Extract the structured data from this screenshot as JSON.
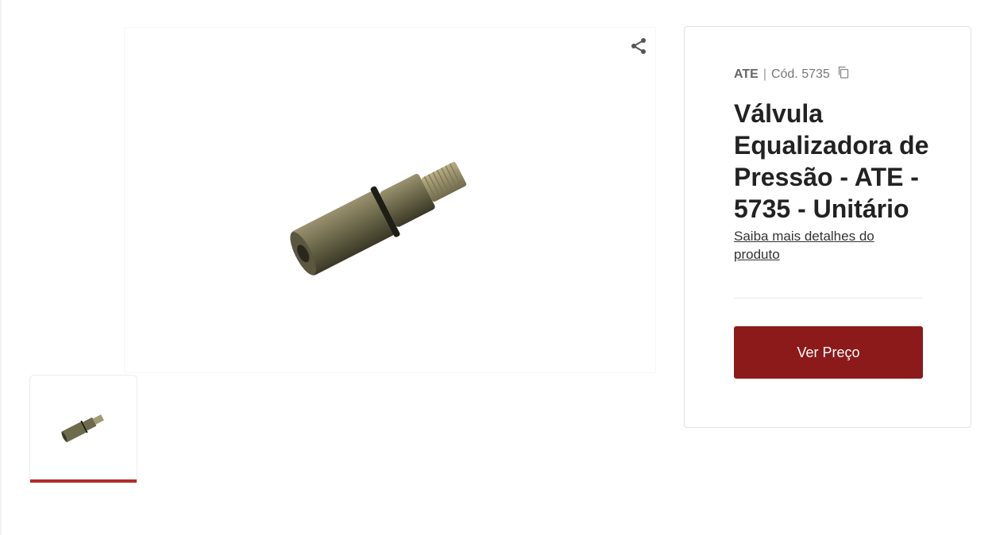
{
  "gallery": {
    "main_image_icon": "brass-pressure-valve-photo",
    "share_icon": "share-icon",
    "thumbnail_icon": "brass-pressure-valve-thumbnail"
  },
  "product": {
    "brand": "ATE",
    "separator": "|",
    "code": "Cód. 5735",
    "copy_icon": "copy-icon",
    "title": "Válvula Equalizadora de Pressão - ATE - 5735 - Unitário",
    "details_link": "Saiba mais detalhes do produto",
    "price_button": "Ver Preço"
  },
  "colors": {
    "accent": "#8c1a1a",
    "thumb_active": "#b32b2b"
  }
}
